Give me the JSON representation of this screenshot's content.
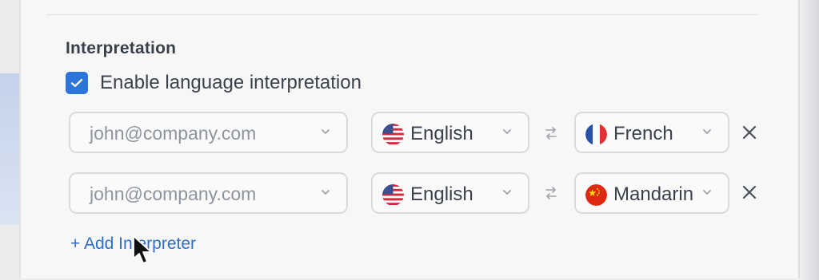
{
  "colors": {
    "accent": "#2d74d9",
    "text_primary": "#3b414b",
    "text_muted": "#8e949c",
    "link": "#2e6fc9",
    "border": "#d8dadd"
  },
  "section": {
    "title": "Interpretation",
    "enable_label": "Enable language interpretation",
    "enable_checked": true
  },
  "interpreters": [
    {
      "email": "john@company.com",
      "source_language": "English",
      "source_flag": "us-flag-icon",
      "target_language": "French",
      "target_flag": "france-flag-icon"
    },
    {
      "email": "john@company.com",
      "source_language": "English",
      "source_flag": "us-flag-icon",
      "target_language": "Mandarin",
      "target_flag": "china-flag-icon"
    }
  ],
  "actions": {
    "add_interpreter": "+ Add Interpreter"
  },
  "icons": {
    "dropdown": "chevron-down-icon",
    "swap": "swap-icon",
    "remove": "close-icon",
    "checkbox": "check-icon",
    "cursor": "mouse-pointer-icon"
  }
}
